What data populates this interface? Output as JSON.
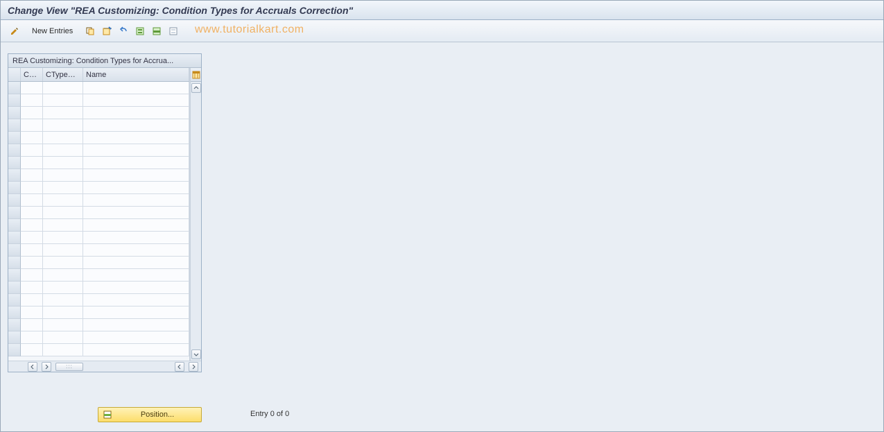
{
  "title": "Change View \"REA Customizing: Condition Types for Accruals Correction\"",
  "watermark": "www.tutorialkart.com",
  "toolbar": {
    "new_entries_label": "New Entries",
    "icons": {
      "edit": "pencil-icon",
      "copy": "copy-icon",
      "delete": "delete-icon",
      "undo": "undo-icon",
      "select_all": "select-all-icon",
      "select_block": "select-block-icon",
      "deselect": "deselect-icon"
    }
  },
  "grid": {
    "title": "REA Customizing: Condition Types for Accrua...",
    "columns": {
      "co": "Co...",
      "ctypecor": "CTypeCor",
      "name": "Name"
    },
    "row_count": 22,
    "config_icon": "table-settings-icon"
  },
  "footer": {
    "position_label": "Position...",
    "entry_label": "Entry 0 of 0"
  },
  "colors": {
    "accent_title": "#333a52",
    "watermark": "#f1a64a",
    "position_bg_top": "#fff2b8",
    "position_bg_bottom": "#fcdd6a"
  }
}
